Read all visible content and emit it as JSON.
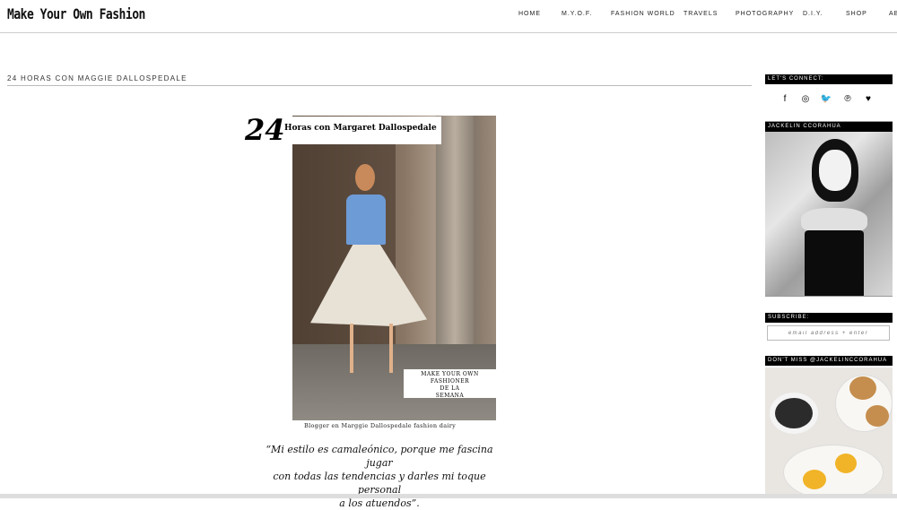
{
  "header": {
    "logo": "Make Your Own Fashion",
    "nav": [
      "HOME",
      "M.Y.O.F.",
      "FASHION WORLD",
      "TRAVELS",
      "PHOTOGRAPHY",
      "D.I.Y.",
      "SHOP",
      "AB"
    ]
  },
  "post": {
    "title": "24 HORAS CON MAGGIE DALLOSPEDALE",
    "image_number": "24",
    "image_title": "Horas con Margaret Dallospedale",
    "image_label_lines": [
      "MAKE YOUR OWN FASHIONER",
      "DE LA",
      "SEMANA"
    ],
    "caption": "Blogger en Marggie Dallospedale fashion dairy",
    "quote_lines": [
      "“Mi estilo es camaleónico, porque me fascina jugar",
      "con todas las tendencias y darles mi toque personal",
      "a los atuendos”."
    ]
  },
  "sidebar": {
    "connect_title": "LET'S CONNECT:",
    "social_icons": [
      "facebook-icon",
      "instagram-icon",
      "twitter-icon",
      "pinterest-icon",
      "heart-icon"
    ],
    "social_glyphs": [
      "f",
      "◎",
      "🐦",
      "℗",
      "♥"
    ],
    "profile_title": "JACKELIN CCORAHUA",
    "subscribe_title": "SUBSCRIBE:",
    "subscribe_placeholder": "email address + enter",
    "instagram_title": "DON'T MISS @JACKELINCCORAHUA"
  }
}
